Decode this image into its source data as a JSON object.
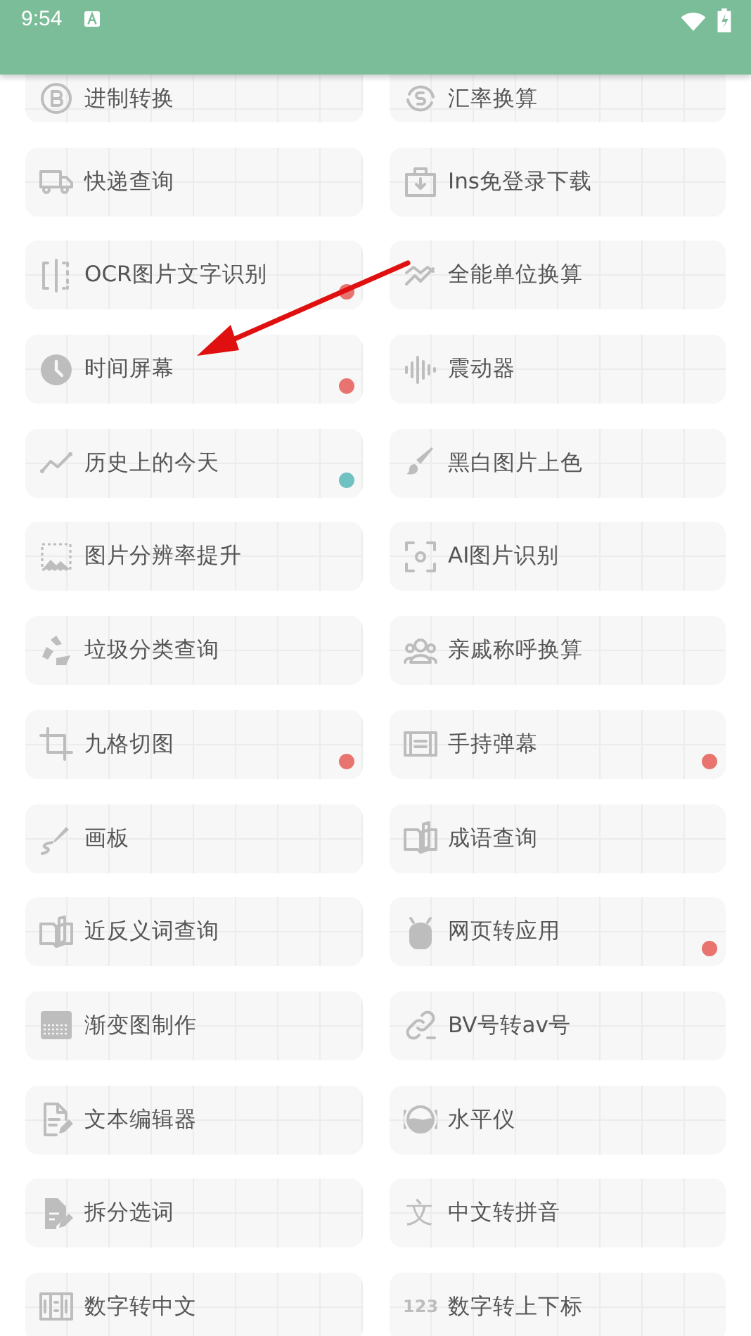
{
  "status_bar": {
    "time": "9:54"
  },
  "tools": [
    {
      "label": "进制转换"
    },
    {
      "label": "汇率换算"
    },
    {
      "label": "快递查询"
    },
    {
      "label": "Ins免登录下载"
    },
    {
      "label": "OCR图片文字识别",
      "color": "#e8736f"
    },
    {
      "label": "全能单位换算"
    },
    {
      "label": "时间屏幕",
      "color": "#e8736f"
    },
    {
      "label": "震动器"
    },
    {
      "label": "历史上的今天",
      "color": "#6fc1c2"
    },
    {
      "label": "黑白图片上色"
    },
    {
      "label": "图片分辨率提升"
    },
    {
      "label": "AI图片识别"
    },
    {
      "label": "垃圾分类查询"
    },
    {
      "label": "亲戚称呼换算"
    },
    {
      "label": "九格切图",
      "color": "#e8736f"
    },
    {
      "label": "手持弹幕",
      "color": "#e8736f"
    },
    {
      "label": "画板"
    },
    {
      "label": "成语查询"
    },
    {
      "label": "近反义词查询"
    },
    {
      "label": "网页转应用",
      "color": "#e8736f"
    },
    {
      "label": "渐变图制作"
    },
    {
      "label": "BV号转av号"
    },
    {
      "label": "文本编辑器"
    },
    {
      "label": "水平仪"
    },
    {
      "label": "拆分选词"
    },
    {
      "label": "中文转拼音",
      "icon_text": "文"
    },
    {
      "label": "数字转中文"
    },
    {
      "label": "数字转上下标",
      "icon_text": "123"
    }
  ]
}
